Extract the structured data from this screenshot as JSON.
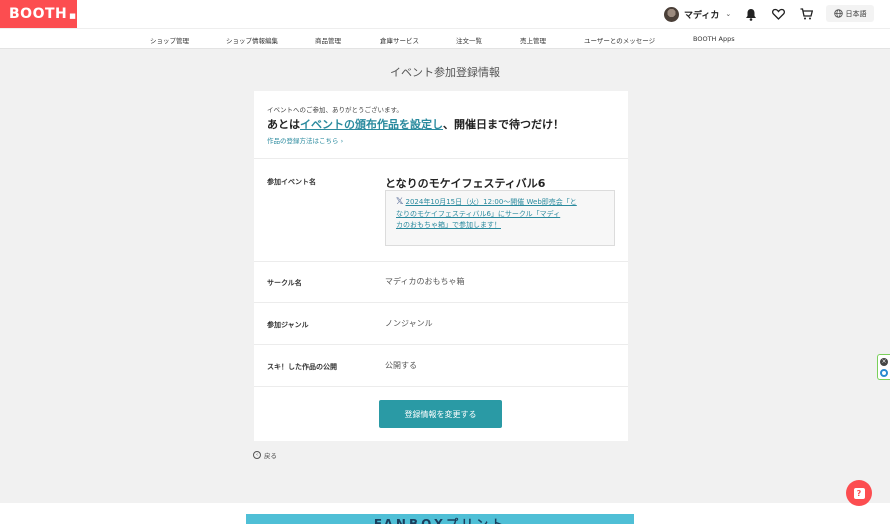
{
  "header": {
    "logo": "BOOTH",
    "user_name": "マディカ",
    "language": "日本語"
  },
  "nav": {
    "items": [
      "ショップ管理",
      "ショップ情報編集",
      "商品管理",
      "倉庫サービス",
      "注文一覧",
      "売上管理",
      "ユーザーとのメッセージ",
      "BOOTH Apps"
    ]
  },
  "page_title": "イベント参加登録情報",
  "card": {
    "thanks": "イベントへのご参加、ありがとうございます。",
    "headline_pre": "あとは",
    "headline_link": "イベントの頒布作品を設定し",
    "headline_post": "、開催日まで待つだけ！",
    "howto_link": "作品の登録方法はこちら ›",
    "rows": {
      "event_label": "参加イベント名",
      "event_name": "となりのモケイフェスティバル6",
      "tweet_line1": "2024年10月15日（火）12:00〜開催 Web即売会「と",
      "tweet_line2": "なりのモケイフェスティバル6」にサークル「マディ",
      "tweet_line3": "カのおもちゃ箱」で参加します！",
      "circle_label": "サークル名",
      "circle_value": "マディカのおもちゃ箱",
      "genre_label": "参加ジャンル",
      "genre_value": "ノンジャンル",
      "suki_label": "スキ！した作品の公開",
      "suki_value": "公開する"
    },
    "button": "登録情報を変更する"
  },
  "back_link": "戻る",
  "banner_text": "FANBOXプリント",
  "colors": {
    "brand": "#fc4d50",
    "accent": "#2a9aa5",
    "link": "#2a8a9e"
  }
}
